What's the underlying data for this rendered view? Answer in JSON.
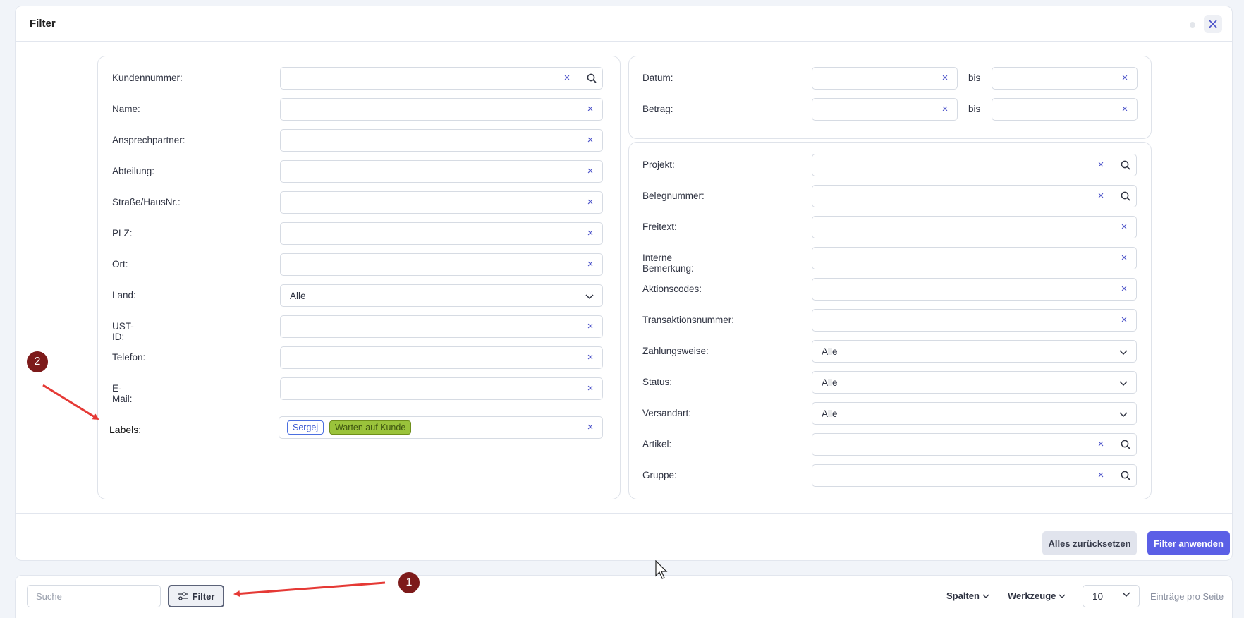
{
  "panel": {
    "title": "Filter"
  },
  "left_fields": [
    {
      "label": "Kundennummer:",
      "type": "search"
    },
    {
      "label": "Name:",
      "type": "text"
    },
    {
      "label": "Ansprechpartner:",
      "type": "text"
    },
    {
      "label": "Abteilung:",
      "type": "text"
    },
    {
      "label": "Straße/HausNr.:",
      "type": "text"
    },
    {
      "label": "PLZ:",
      "type": "text"
    },
    {
      "label": "Ort:",
      "type": "text"
    },
    {
      "label": "Land:",
      "type": "select",
      "value": "Alle"
    },
    {
      "label": "UST-ID:",
      "type": "text"
    },
    {
      "label": "Telefon:",
      "type": "text"
    },
    {
      "label": "E-Mail:",
      "type": "text"
    }
  ],
  "labels_field": {
    "label": "Labels:",
    "tags": [
      "Sergej",
      "Warten auf Kunde"
    ]
  },
  "range_fields": [
    {
      "label": "Datum:",
      "separator": "bis"
    },
    {
      "label": "Betrag:",
      "separator": "bis"
    }
  ],
  "right_fields": [
    {
      "label": "Projekt:",
      "type": "search"
    },
    {
      "label": "Belegnummer:",
      "type": "search"
    },
    {
      "label": "Freitext:",
      "type": "text"
    },
    {
      "label": "Interne Bemerkung:",
      "type": "text"
    },
    {
      "label": "Aktionscodes:",
      "type": "text"
    },
    {
      "label": "Transaktionsnummer:",
      "type": "text"
    },
    {
      "label": "Zahlungsweise:",
      "type": "select",
      "value": "Alle"
    },
    {
      "label": "Status:",
      "type": "select",
      "value": "Alle"
    },
    {
      "label": "Versandart:",
      "type": "select",
      "value": "Alle"
    },
    {
      "label": "Artikel:",
      "type": "search"
    },
    {
      "label": "Gruppe:",
      "type": "search"
    }
  ],
  "footer": {
    "reset_label": "Alles zurücksetzen",
    "apply_label": "Filter anwenden"
  },
  "toolbar": {
    "search_placeholder": "Suche",
    "filter_label": "Filter",
    "columns_label": "Spalten",
    "tools_label": "Werkzeuge",
    "per_page_value": "10",
    "per_page_label": "Einträge pro Seite"
  },
  "annotations": {
    "badge_1": "1",
    "badge_2": "2"
  },
  "colors": {
    "accent": "#5b5fe6",
    "badge": "#7d1a1a",
    "arrow": "#e53935",
    "tag_green": "#9ac33b"
  }
}
